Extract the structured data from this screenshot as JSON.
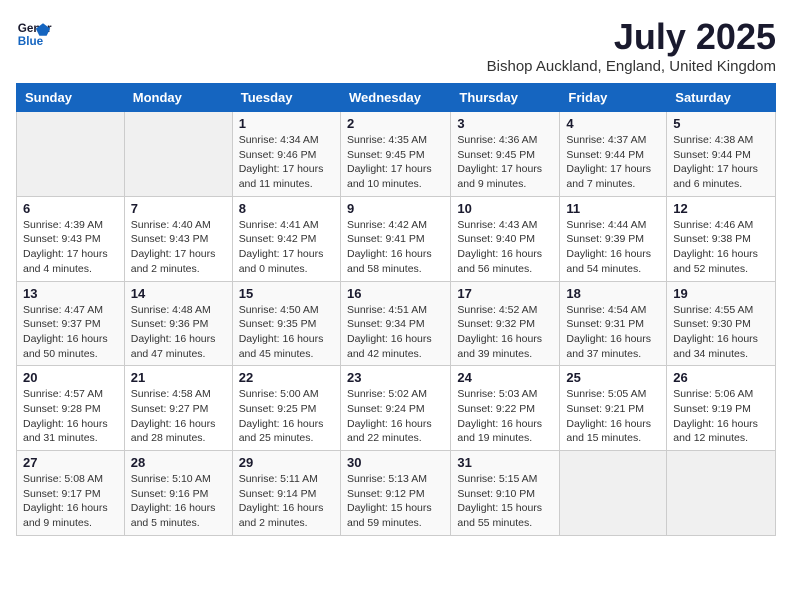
{
  "header": {
    "logo_line1": "General",
    "logo_line2": "Blue",
    "main_title": "July 2025",
    "subtitle": "Bishop Auckland, England, United Kingdom"
  },
  "days_of_week": [
    "Sunday",
    "Monday",
    "Tuesday",
    "Wednesday",
    "Thursday",
    "Friday",
    "Saturday"
  ],
  "weeks": [
    [
      {
        "day": "",
        "info": ""
      },
      {
        "day": "",
        "info": ""
      },
      {
        "day": "1",
        "info": "Sunrise: 4:34 AM\nSunset: 9:46 PM\nDaylight: 17 hours and 11 minutes."
      },
      {
        "day": "2",
        "info": "Sunrise: 4:35 AM\nSunset: 9:45 PM\nDaylight: 17 hours and 10 minutes."
      },
      {
        "day": "3",
        "info": "Sunrise: 4:36 AM\nSunset: 9:45 PM\nDaylight: 17 hours and 9 minutes."
      },
      {
        "day": "4",
        "info": "Sunrise: 4:37 AM\nSunset: 9:44 PM\nDaylight: 17 hours and 7 minutes."
      },
      {
        "day": "5",
        "info": "Sunrise: 4:38 AM\nSunset: 9:44 PM\nDaylight: 17 hours and 6 minutes."
      }
    ],
    [
      {
        "day": "6",
        "info": "Sunrise: 4:39 AM\nSunset: 9:43 PM\nDaylight: 17 hours and 4 minutes."
      },
      {
        "day": "7",
        "info": "Sunrise: 4:40 AM\nSunset: 9:43 PM\nDaylight: 17 hours and 2 minutes."
      },
      {
        "day": "8",
        "info": "Sunrise: 4:41 AM\nSunset: 9:42 PM\nDaylight: 17 hours and 0 minutes."
      },
      {
        "day": "9",
        "info": "Sunrise: 4:42 AM\nSunset: 9:41 PM\nDaylight: 16 hours and 58 minutes."
      },
      {
        "day": "10",
        "info": "Sunrise: 4:43 AM\nSunset: 9:40 PM\nDaylight: 16 hours and 56 minutes."
      },
      {
        "day": "11",
        "info": "Sunrise: 4:44 AM\nSunset: 9:39 PM\nDaylight: 16 hours and 54 minutes."
      },
      {
        "day": "12",
        "info": "Sunrise: 4:46 AM\nSunset: 9:38 PM\nDaylight: 16 hours and 52 minutes."
      }
    ],
    [
      {
        "day": "13",
        "info": "Sunrise: 4:47 AM\nSunset: 9:37 PM\nDaylight: 16 hours and 50 minutes."
      },
      {
        "day": "14",
        "info": "Sunrise: 4:48 AM\nSunset: 9:36 PM\nDaylight: 16 hours and 47 minutes."
      },
      {
        "day": "15",
        "info": "Sunrise: 4:50 AM\nSunset: 9:35 PM\nDaylight: 16 hours and 45 minutes."
      },
      {
        "day": "16",
        "info": "Sunrise: 4:51 AM\nSunset: 9:34 PM\nDaylight: 16 hours and 42 minutes."
      },
      {
        "day": "17",
        "info": "Sunrise: 4:52 AM\nSunset: 9:32 PM\nDaylight: 16 hours and 39 minutes."
      },
      {
        "day": "18",
        "info": "Sunrise: 4:54 AM\nSunset: 9:31 PM\nDaylight: 16 hours and 37 minutes."
      },
      {
        "day": "19",
        "info": "Sunrise: 4:55 AM\nSunset: 9:30 PM\nDaylight: 16 hours and 34 minutes."
      }
    ],
    [
      {
        "day": "20",
        "info": "Sunrise: 4:57 AM\nSunset: 9:28 PM\nDaylight: 16 hours and 31 minutes."
      },
      {
        "day": "21",
        "info": "Sunrise: 4:58 AM\nSunset: 9:27 PM\nDaylight: 16 hours and 28 minutes."
      },
      {
        "day": "22",
        "info": "Sunrise: 5:00 AM\nSunset: 9:25 PM\nDaylight: 16 hours and 25 minutes."
      },
      {
        "day": "23",
        "info": "Sunrise: 5:02 AM\nSunset: 9:24 PM\nDaylight: 16 hours and 22 minutes."
      },
      {
        "day": "24",
        "info": "Sunrise: 5:03 AM\nSunset: 9:22 PM\nDaylight: 16 hours and 19 minutes."
      },
      {
        "day": "25",
        "info": "Sunrise: 5:05 AM\nSunset: 9:21 PM\nDaylight: 16 hours and 15 minutes."
      },
      {
        "day": "26",
        "info": "Sunrise: 5:06 AM\nSunset: 9:19 PM\nDaylight: 16 hours and 12 minutes."
      }
    ],
    [
      {
        "day": "27",
        "info": "Sunrise: 5:08 AM\nSunset: 9:17 PM\nDaylight: 16 hours and 9 minutes."
      },
      {
        "day": "28",
        "info": "Sunrise: 5:10 AM\nSunset: 9:16 PM\nDaylight: 16 hours and 5 minutes."
      },
      {
        "day": "29",
        "info": "Sunrise: 5:11 AM\nSunset: 9:14 PM\nDaylight: 16 hours and 2 minutes."
      },
      {
        "day": "30",
        "info": "Sunrise: 5:13 AM\nSunset: 9:12 PM\nDaylight: 15 hours and 59 minutes."
      },
      {
        "day": "31",
        "info": "Sunrise: 5:15 AM\nSunset: 9:10 PM\nDaylight: 15 hours and 55 minutes."
      },
      {
        "day": "",
        "info": ""
      },
      {
        "day": "",
        "info": ""
      }
    ]
  ]
}
